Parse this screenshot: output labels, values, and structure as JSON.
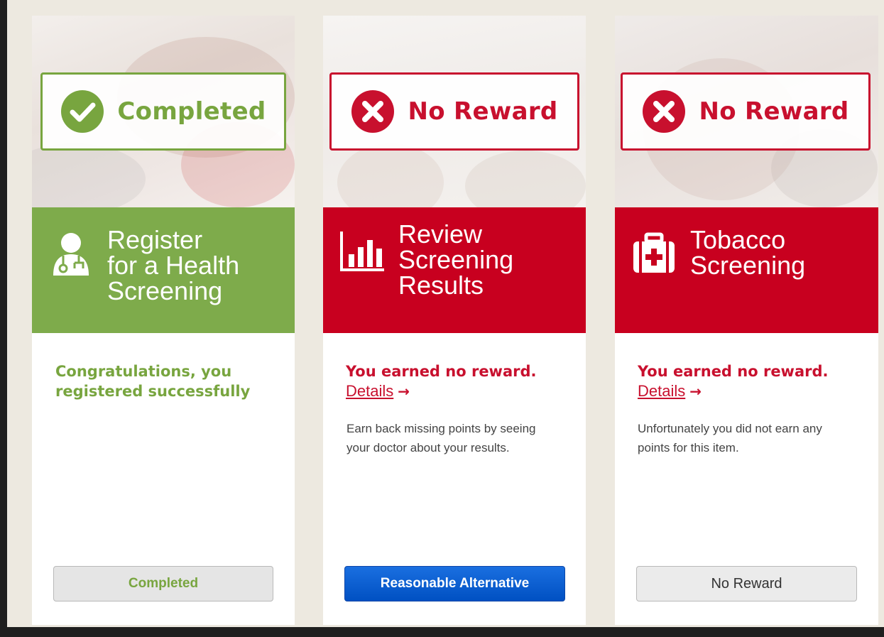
{
  "cards": [
    {
      "status": {
        "label": "Completed",
        "icon": "check-circle-icon",
        "color": "#78a53f"
      },
      "banner": {
        "title": "Register\nfor a Health\nScreening",
        "icon": "doctor-icon",
        "color": "#7eab4b"
      },
      "message": "Congratulations, you registered successfully",
      "button": {
        "label": "Completed"
      }
    },
    {
      "status": {
        "label": "No Reward",
        "icon": "x-circle-icon",
        "color": "#c8102e"
      },
      "banner": {
        "title": "Review\nScreening\nResults",
        "icon": "bar-chart-icon",
        "color": "#c8001f"
      },
      "message": "You earned no reward.",
      "details_label": "Details",
      "arrow": "→",
      "subtext": "Earn back missing points by seeing your doctor about your results.",
      "button": {
        "label": "Reasonable Alternative",
        "color": "#0050c2"
      }
    },
    {
      "status": {
        "label": "No Reward",
        "icon": "x-circle-icon",
        "color": "#c8102e"
      },
      "banner": {
        "title": "Tobacco\nScreening",
        "icon": "medical-kit-icon",
        "color": "#c8001f"
      },
      "message": "You earned no reward.",
      "details_label": "Details",
      "arrow": "→",
      "subtext": "Unfortunately you did not earn any points for this item.",
      "button": {
        "label": "No Reward"
      }
    }
  ]
}
